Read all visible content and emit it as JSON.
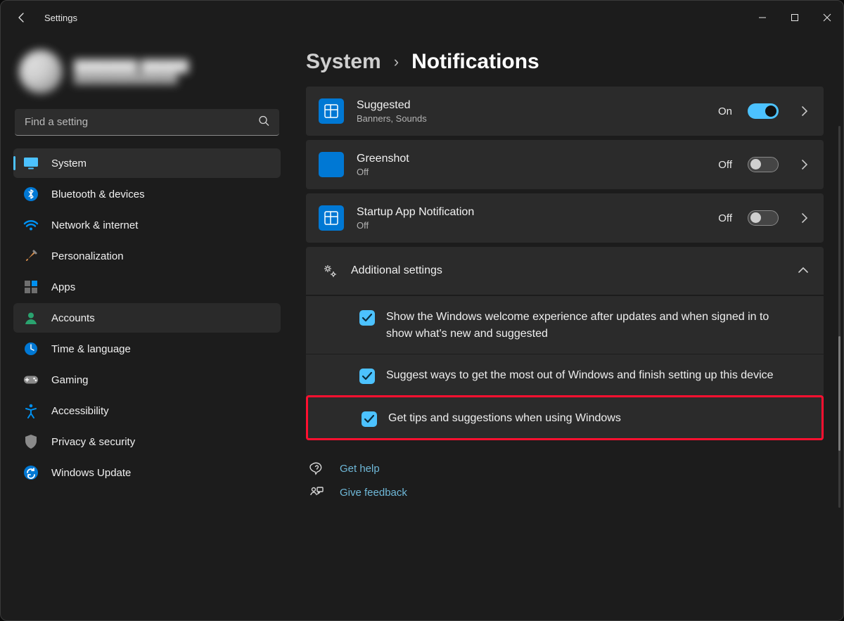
{
  "window": {
    "title": "Settings"
  },
  "user": {
    "name": "████████ ██████",
    "email": "████████████████"
  },
  "search": {
    "placeholder": "Find a setting"
  },
  "sidebar": {
    "items": [
      {
        "label": "System"
      },
      {
        "label": "Bluetooth & devices"
      },
      {
        "label": "Network & internet"
      },
      {
        "label": "Personalization"
      },
      {
        "label": "Apps"
      },
      {
        "label": "Accounts"
      },
      {
        "label": "Time & language"
      },
      {
        "label": "Gaming"
      },
      {
        "label": "Accessibility"
      },
      {
        "label": "Privacy & security"
      },
      {
        "label": "Windows Update"
      }
    ]
  },
  "breadcrumb": {
    "parent": "System",
    "current": "Notifications"
  },
  "apps": [
    {
      "name": "Suggested",
      "detail": "Banners, Sounds",
      "state": "On",
      "on": true
    },
    {
      "name": "Greenshot",
      "detail": "Off",
      "state": "Off",
      "on": false
    },
    {
      "name": "Startup App Notification",
      "detail": "Off",
      "state": "Off",
      "on": false
    }
  ],
  "additional": {
    "title": "Additional settings",
    "items": [
      {
        "label": "Show the Windows welcome experience after updates and when signed in to show what's new and suggested",
        "checked": true
      },
      {
        "label": "Suggest ways to get the most out of Windows and finish setting up this device",
        "checked": true
      },
      {
        "label": "Get tips and suggestions when using Windows",
        "checked": true
      }
    ]
  },
  "help": {
    "get_help": "Get help",
    "feedback": "Give feedback"
  }
}
